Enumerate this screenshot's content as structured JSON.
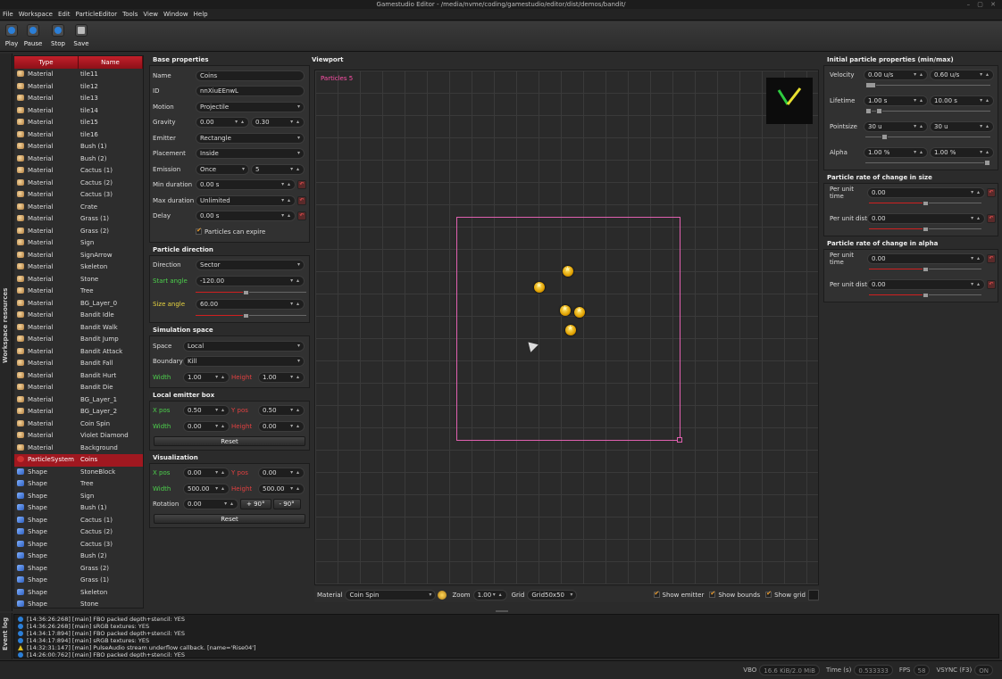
{
  "window": {
    "title": "Gamestudio Editor - /media/nvme/coding/gamestudio/editor/dist/demos/bandit/",
    "controls": "– ▢ ✕"
  },
  "menu": [
    "File",
    "Workspace",
    "Edit",
    "ParticleEditor",
    "Tools",
    "View",
    "Window",
    "Help"
  ],
  "toolbar": {
    "play": "Play",
    "pause": "Pause",
    "stop": "Stop",
    "save": "Save"
  },
  "side_tabs": {
    "resources": "Workspace resources",
    "log": "Event log"
  },
  "resources": {
    "headers": {
      "type": "Type",
      "name": "Name"
    },
    "rows": [
      {
        "type": "Material",
        "name": "tile11",
        "icon": "material"
      },
      {
        "type": "Material",
        "name": "tile12",
        "icon": "material"
      },
      {
        "type": "Material",
        "name": "tile13",
        "icon": "material"
      },
      {
        "type": "Material",
        "name": "tile14",
        "icon": "material"
      },
      {
        "type": "Material",
        "name": "tile15",
        "icon": "material"
      },
      {
        "type": "Material",
        "name": "tile16",
        "icon": "material"
      },
      {
        "type": "Material",
        "name": "Bush (1)",
        "icon": "material"
      },
      {
        "type": "Material",
        "name": "Bush (2)",
        "icon": "material"
      },
      {
        "type": "Material",
        "name": "Cactus (1)",
        "icon": "material"
      },
      {
        "type": "Material",
        "name": "Cactus (2)",
        "icon": "material"
      },
      {
        "type": "Material",
        "name": "Cactus (3)",
        "icon": "material"
      },
      {
        "type": "Material",
        "name": "Crate",
        "icon": "material"
      },
      {
        "type": "Material",
        "name": "Grass (1)",
        "icon": "material"
      },
      {
        "type": "Material",
        "name": "Grass (2)",
        "icon": "material"
      },
      {
        "type": "Material",
        "name": "Sign",
        "icon": "material"
      },
      {
        "type": "Material",
        "name": "SignArrow",
        "icon": "material"
      },
      {
        "type": "Material",
        "name": "Skeleton",
        "icon": "material"
      },
      {
        "type": "Material",
        "name": "Stone",
        "icon": "material"
      },
      {
        "type": "Material",
        "name": "Tree",
        "icon": "material"
      },
      {
        "type": "Material",
        "name": "BG_Layer_0",
        "icon": "material"
      },
      {
        "type": "Material",
        "name": "Bandit Idle",
        "icon": "material"
      },
      {
        "type": "Material",
        "name": "Bandit Walk",
        "icon": "material"
      },
      {
        "type": "Material",
        "name": "Bandit Jump",
        "icon": "material"
      },
      {
        "type": "Material",
        "name": "Bandit Attack",
        "icon": "material"
      },
      {
        "type": "Material",
        "name": "Bandit Fall",
        "icon": "material"
      },
      {
        "type": "Material",
        "name": "Bandit Hurt",
        "icon": "material"
      },
      {
        "type": "Material",
        "name": "Bandit Die",
        "icon": "material"
      },
      {
        "type": "Material",
        "name": "BG_Layer_1",
        "icon": "material"
      },
      {
        "type": "Material",
        "name": "BG_Layer_2",
        "icon": "material"
      },
      {
        "type": "Material",
        "name": "Coin Spin",
        "icon": "material"
      },
      {
        "type": "Material",
        "name": "Violet Diamond",
        "icon": "material"
      },
      {
        "type": "Material",
        "name": "Background",
        "icon": "material"
      },
      {
        "type": "ParticleSystem",
        "name": "Coins",
        "icon": "particle",
        "selected": true
      },
      {
        "type": "Shape",
        "name": "StoneBlock",
        "icon": "shape"
      },
      {
        "type": "Shape",
        "name": "Tree",
        "icon": "shape"
      },
      {
        "type": "Shape",
        "name": "Sign",
        "icon": "shape"
      },
      {
        "type": "Shape",
        "name": "Bush (1)",
        "icon": "shape"
      },
      {
        "type": "Shape",
        "name": "Cactus (1)",
        "icon": "shape"
      },
      {
        "type": "Shape",
        "name": "Cactus (2)",
        "icon": "shape"
      },
      {
        "type": "Shape",
        "name": "Cactus (3)",
        "icon": "shape"
      },
      {
        "type": "Shape",
        "name": "Bush (2)",
        "icon": "shape"
      },
      {
        "type": "Shape",
        "name": "Grass (2)",
        "icon": "shape"
      },
      {
        "type": "Shape",
        "name": "Grass (1)",
        "icon": "shape"
      },
      {
        "type": "Shape",
        "name": "Skeleton",
        "icon": "shape"
      },
      {
        "type": "Shape",
        "name": "Stone",
        "icon": "shape"
      }
    ]
  },
  "base": {
    "title": "Base properties",
    "name_label": "Name",
    "name": "Coins",
    "id_label": "ID",
    "id": "nnXiuEEnwL",
    "motion_label": "Motion",
    "motion": "Projectile",
    "gravity_label": "Gravity",
    "gravity_x": "0.00",
    "gravity_y": "0.30",
    "emitter_label": "Emitter",
    "emitter": "Rectangle",
    "placement_label": "Placement",
    "placement": "Inside",
    "emission_label": "Emission",
    "emission": "Once",
    "emission_count": "5",
    "min_duration_label": "Min duration",
    "min_duration": "0.00 s",
    "max_duration_label": "Max duration",
    "max_duration": "Unlimited",
    "delay_label": "Delay",
    "delay": "0.00 s",
    "expire_label": "Particles can expire"
  },
  "direction": {
    "title": "Particle direction",
    "direction_label": "Direction",
    "direction": "Sector",
    "start_label": "Start angle",
    "start": "-120.00",
    "start_level": 0.45,
    "size_label": "Size angle",
    "size": "60.00",
    "size_level": 0.45
  },
  "simspace": {
    "title": "Simulation space",
    "space_label": "Space",
    "space": "Local",
    "boundary_label": "Boundary",
    "boundary": "Kill",
    "width_label": "Width",
    "width": "1.00",
    "height_label": "Height",
    "height": "1.00"
  },
  "emitterbox": {
    "title": "Local emitter box",
    "xpos_label": "X pos",
    "xpos": "0.50",
    "ypos_label": "Y pos",
    "ypos": "0.50",
    "width_label": "Width",
    "width": "0.00",
    "height_label": "Height",
    "height": "0.00",
    "reset": "Reset"
  },
  "vis": {
    "title": "Visualization",
    "xpos_label": "X pos",
    "xpos": "0.00",
    "ypos_label": "Y pos",
    "ypos": "0.00",
    "width_label": "Width",
    "width": "500.00",
    "height_label": "Height",
    "height": "500.00",
    "rotation_label": "Rotation",
    "rotation": "0.00",
    "plus90": "+ 90°",
    "minus90": "- 90°",
    "reset": "Reset"
  },
  "viewport": {
    "title": "Viewport",
    "particles": "Particles 5",
    "material_label": "Material",
    "material": "Coin Spin",
    "zoom_label": "Zoom",
    "zoom": "1.00",
    "grid_label": "Grid",
    "grid": "Grid50x50",
    "show_emitter": "Show emitter",
    "show_bounds": "Show bounds",
    "show_grid": "Show grid"
  },
  "initial": {
    "title": "Initial particle properties (min/max)",
    "velocity_label": "Velocity",
    "velocity_min": "0.00 u/s",
    "velocity_max": "0.60 u/s",
    "lifetime_label": "Lifetime",
    "lifetime_min": "1.00 s",
    "lifetime_max": "10.00 s",
    "pointsize_label": "Pointsize",
    "pointsize_min": "30 u",
    "pointsize_max": "30 u",
    "alpha_label": "Alpha",
    "alpha_min": "1.00 %",
    "alpha_max": "1.00 %"
  },
  "sizerate": {
    "title": "Particle rate of change in size",
    "time_label": "Per unit time",
    "time": "0.00",
    "time_level": 0.5,
    "dist_label": "Per unit dist",
    "dist": "0.00",
    "dist_level": 0.5
  },
  "alpharate": {
    "title": "Particle rate of change in alpha",
    "time_label": "Per unit time",
    "time": "0.00",
    "time_level": 0.5,
    "dist_label": "Per unit dist",
    "dist": "0.00",
    "dist_level": 0.5
  },
  "log": [
    {
      "kind": "info",
      "text": "[14:36:26:268] [main] FBO packed depth+stencil: YES"
    },
    {
      "kind": "info",
      "text": "[14:36:26:268] [main] sRGB textures: YES"
    },
    {
      "kind": "info",
      "text": "[14:34:17:894] [main] FBO packed depth+stencil: YES"
    },
    {
      "kind": "info",
      "text": "[14:34:17:894] [main] sRGB textures: YES"
    },
    {
      "kind": "warn",
      "text": "[14:32:31:147] [main] PulseAudio stream underflow callback. [name='Rise04']"
    },
    {
      "kind": "info",
      "text": "[14:26:00:762] [main] FBO packed depth+stencil: YES"
    }
  ],
  "status": {
    "vbo_label": "VBO",
    "vbo": "16.6 KiB/2.0 MiB",
    "time_label": "Time (s)",
    "time": "0.533333",
    "fps_label": "FPS",
    "fps": "58",
    "vsync_label": "VSYNC (F3)",
    "vsync": "ON"
  }
}
